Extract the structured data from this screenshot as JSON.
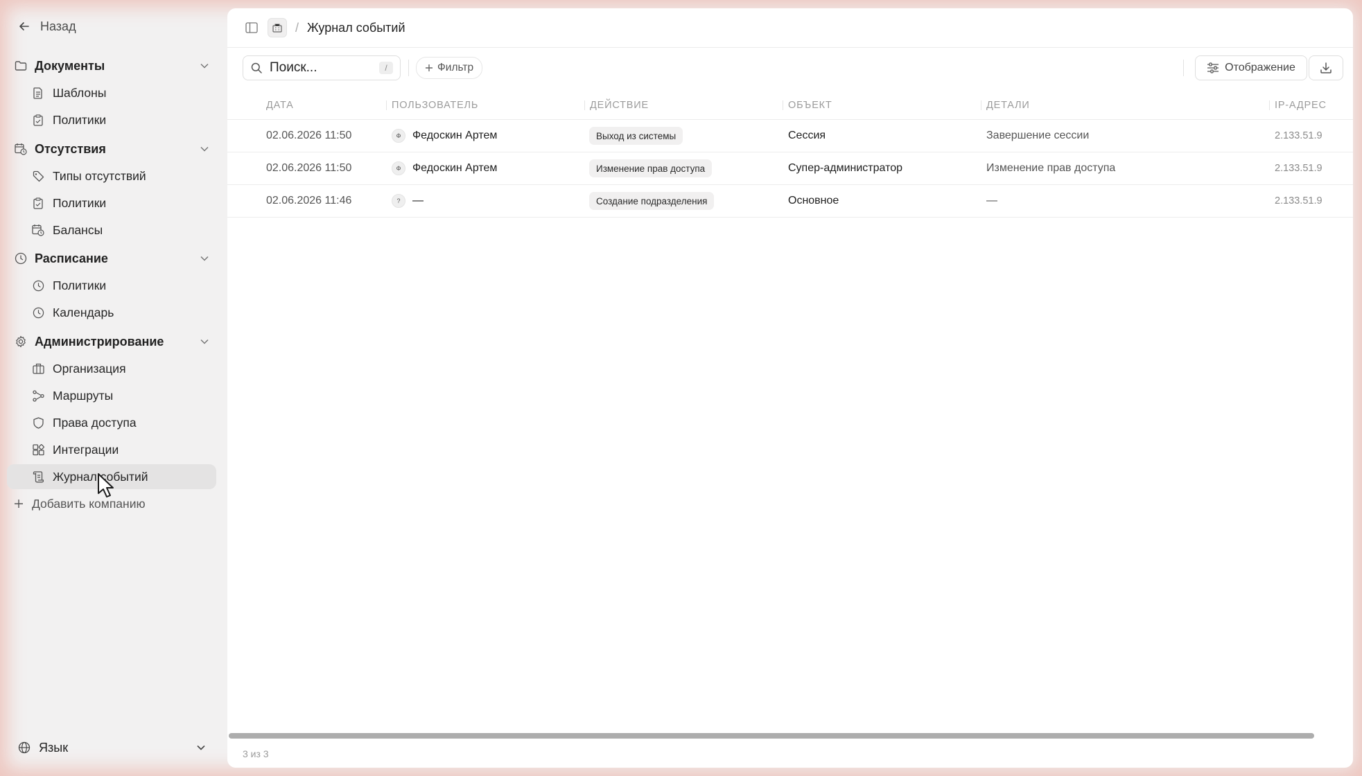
{
  "sidebar": {
    "back_label": "Назад",
    "groups": [
      {
        "title": "Документы",
        "icon": "folder-icon",
        "items": [
          {
            "label": "Шаблоны",
            "icon": "document-icon"
          },
          {
            "label": "Политики",
            "icon": "clipboard-icon"
          }
        ]
      },
      {
        "title": "Отсутствия",
        "icon": "calendar-clock-icon",
        "items": [
          {
            "label": "Типы отсутствий",
            "icon": "tag-icon"
          },
          {
            "label": "Политики",
            "icon": "clipboard-icon"
          },
          {
            "label": "Балансы",
            "icon": "calendar-clock-icon"
          }
        ]
      },
      {
        "title": "Расписание",
        "icon": "clock-icon",
        "items": [
          {
            "label": "Политики",
            "icon": "clock-icon"
          },
          {
            "label": "Календарь",
            "icon": "clock-icon"
          }
        ]
      },
      {
        "title": "Администрирование",
        "icon": "gear-icon",
        "items": [
          {
            "label": "Организация",
            "icon": "building-icon"
          },
          {
            "label": "Маршруты",
            "icon": "route-icon"
          },
          {
            "label": "Права доступа",
            "icon": "shield-icon"
          },
          {
            "label": "Интеграции",
            "icon": "integrations-icon"
          },
          {
            "label": "Журнал событий",
            "icon": "log-icon",
            "active": true
          }
        ]
      }
    ],
    "add_company_label": "Добавить компанию",
    "language_label": "Язык"
  },
  "topbar": {
    "breadcrumb": "Журнал событий"
  },
  "toolbar": {
    "search_placeholder": "Поиск...",
    "search_shortcut": "/",
    "filter_label": "Фильтр",
    "display_label": "Отображение"
  },
  "table": {
    "columns": [
      "ДАТА",
      "ПОЛЬЗОВАТЕЛЬ",
      "ДЕЙСТВИЕ",
      "ОБЪЕКТ",
      "ДЕТАЛИ",
      "IP-АДРЕС"
    ],
    "rows": [
      {
        "date": "02.06.2026 11:50",
        "avatar": "Ф",
        "user": "Федоскин Артем",
        "action": "Выход из системы",
        "object": "Сессия",
        "details": "Завершение сессии",
        "ip": "2.133.51.9"
      },
      {
        "date": "02.06.2026 11:50",
        "avatar": "Ф",
        "user": "Федоскин Артем",
        "action": "Изменение прав доступа",
        "object": "Супер-администратор",
        "details": "Изменение прав доступа",
        "ip": "2.133.51.9"
      },
      {
        "date": "02.06.2026 11:46",
        "avatar": "?",
        "user": "—",
        "action": "Создание подразделения",
        "object": "Основное",
        "details": "—",
        "ip": "2.133.51.9"
      }
    ]
  },
  "footer": {
    "count_text": "3 из 3"
  }
}
